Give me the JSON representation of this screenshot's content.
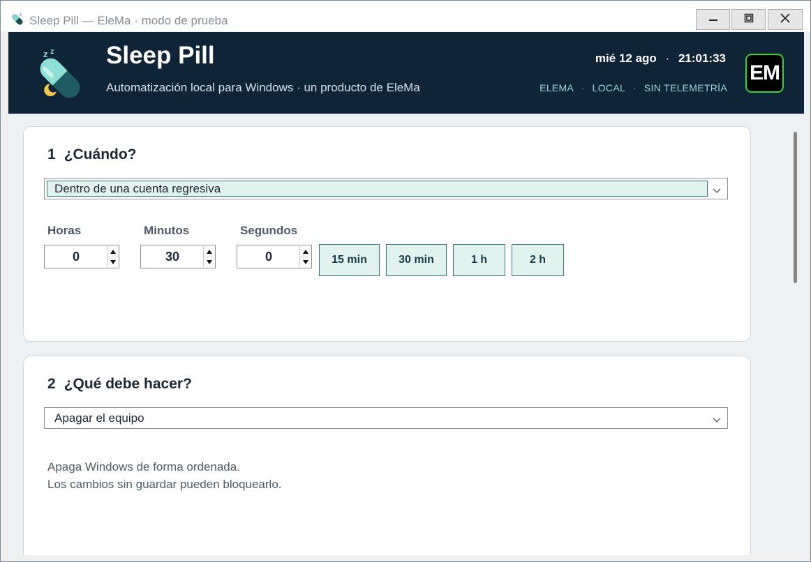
{
  "window": {
    "title": "Sleep Pill — EleMa · modo de prueba",
    "icon": "pill-icon",
    "controls": [
      "minimize-icon",
      "maximize-icon",
      "close-icon"
    ]
  },
  "header": {
    "title": "Sleep Pill",
    "subtitle": "Automatización local para Windows · un producto de EleMa",
    "date": "mié 12 ago",
    "separator": "·",
    "time": "21:01:33",
    "tags": [
      "ELEMA",
      "LOCAL",
      "SIN TELEMETRÍA"
    ],
    "badge": "EM",
    "colors": {
      "header_bg": "#0f2537",
      "tag_color": "#9fd6de",
      "badge_border": "#3bd62a",
      "accent": "#2f7a70",
      "accent_fill": "#e2f2ee"
    }
  },
  "when": {
    "number": "1",
    "title": "¿Cuándo?",
    "mode_selected": "Dentro de una cuenta regresiva",
    "fields": [
      {
        "label": "Horas",
        "value": "0"
      },
      {
        "label": "Minutos",
        "value": "30"
      },
      {
        "label": "Segundos",
        "value": "0"
      }
    ],
    "presets": [
      "15 min",
      "30 min",
      "1 h",
      "2 h"
    ]
  },
  "action": {
    "number": "2",
    "title": "¿Qué debe hacer?",
    "selected": "Apagar el equipo",
    "description": [
      "Apaga Windows de forma ordenada.",
      "Los cambios sin guardar pueden bloquearlo."
    ]
  }
}
